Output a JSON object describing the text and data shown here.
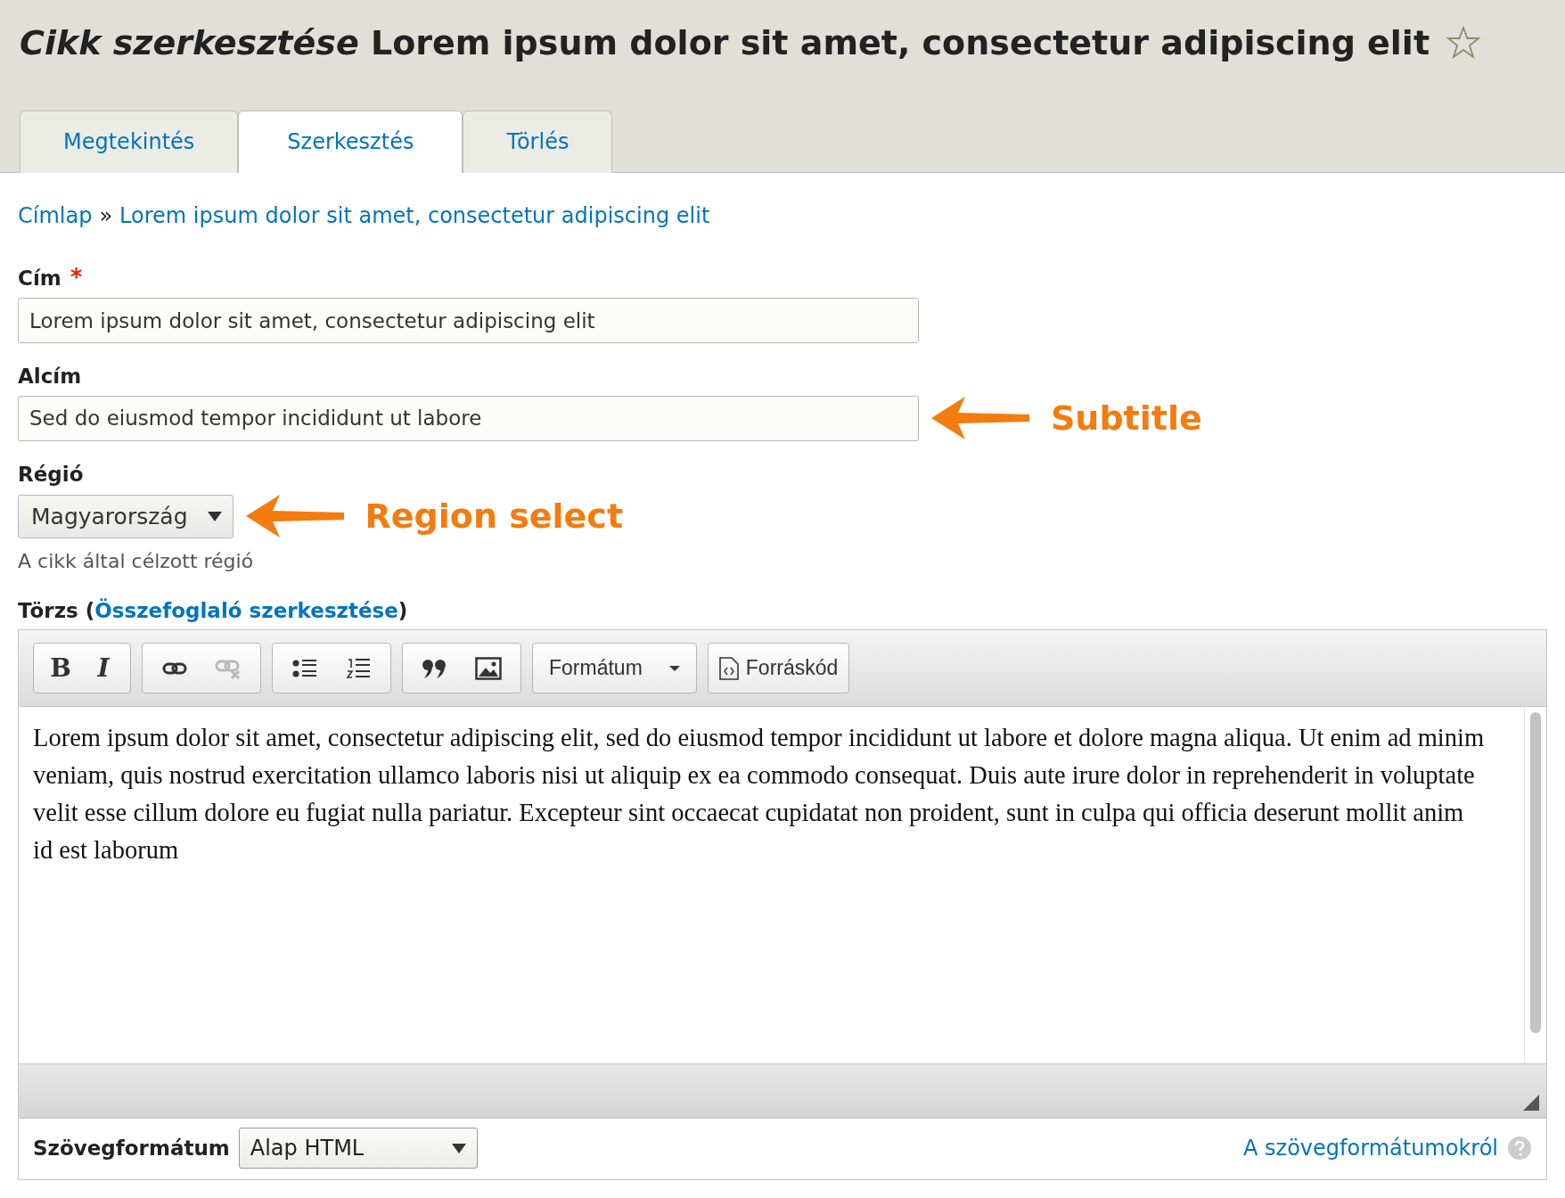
{
  "page_title": "*Cikk szerkesztése* Lorem ipsum dolor sit amet, consectetur adipiscing elit",
  "favorite": {
    "starred": false
  },
  "tabs": [
    {
      "label": "Megtekintés",
      "selected": false
    },
    {
      "label": "Szerkesztés",
      "selected": true
    },
    {
      "label": "Törlés",
      "selected": false
    }
  ],
  "breadcrumb": [
    {
      "label": "Címlap"
    },
    {
      "label": "Lorem ipsum dolor sit amet, consectetur adipiscing elit"
    }
  ],
  "breadcrumb_separator": "»",
  "required_marker": "*",
  "fields": [
    {
      "kind": "text",
      "label": "Cím",
      "required": true,
      "value": "Lorem ipsum dolor sit amet, consectetur adipiscing elit"
    },
    {
      "kind": "text",
      "label": "Alcím",
      "required": false,
      "value": "Sed do eiusmod tempor incididunt ut labore",
      "annotation": "Subtitle"
    },
    {
      "kind": "select",
      "label": "Régió",
      "required": false,
      "value": "Magyarország",
      "description": "A cikk által célzott régió",
      "annotation": "Region select"
    }
  ],
  "body": {
    "label": "Törzs",
    "label_open": "(",
    "link": "Összefoglaló szerkesztése",
    "label_close": ")",
    "toolbar": [
      [
        {
          "kind": "bold",
          "label": "B",
          "disabled": false
        },
        {
          "kind": "italic",
          "label": "I",
          "disabled": false
        }
      ],
      [
        {
          "kind": "link",
          "disabled": false
        },
        {
          "kind": "unlink",
          "disabled": true
        }
      ],
      [
        {
          "kind": "bulleted",
          "disabled": false
        },
        {
          "kind": "numbered",
          "disabled": false
        }
      ],
      [
        {
          "kind": "quote",
          "disabled": false
        },
        {
          "kind": "image",
          "disabled": false
        }
      ],
      [
        {
          "kind": "format",
          "label": "Formátum",
          "disabled": false
        }
      ],
      [
        {
          "kind": "source",
          "label": "Forráskód",
          "disabled": false
        }
      ]
    ],
    "content": "Lorem ipsum dolor sit amet, consectetur adipiscing elit, sed do eiusmod tempor incididunt ut labore et dolore magna aliqua. Ut enim ad minim veniam, quis nostrud exercitation ullamco laboris nisi ut aliquip ex ea commodo consequat. Duis aute irure dolor in reprehenderit in voluptate velit esse cillum dolore eu fugiat nulla pariatur. Excepteur sint occaecat cupidatat non proident, sunt in culpa qui officia deserunt mollit anim id est laborum",
    "format_label": "Szövegformátum",
    "format_value": "Alap HTML",
    "format_help": "A szövegformátumokról"
  }
}
